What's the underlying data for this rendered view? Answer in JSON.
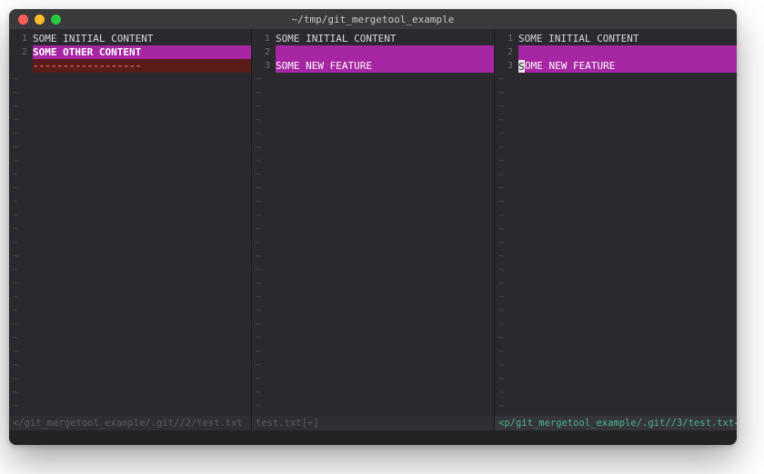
{
  "window": {
    "title": "~/tmp/git_mergetool_example"
  },
  "panes": [
    {
      "id": "local",
      "status_style": "inactive",
      "status_left": "</git_mergetool_example/.git//2/test.txt",
      "status_right": "",
      "lines": [
        {
          "num": "1",
          "kind": "plain",
          "text": "SOME INITIAL CONTENT"
        },
        {
          "num": "2",
          "kind": "purple-bold",
          "text": "SOME OTHER CONTENT"
        },
        {
          "num": "",
          "kind": "removed",
          "text": "------------------"
        }
      ]
    },
    {
      "id": "base",
      "status_style": "inactive",
      "status_left": "test.txt[+]",
      "status_right": "",
      "lines": [
        {
          "num": "1",
          "kind": "plain",
          "text": "SOME INITIAL CONTENT"
        },
        {
          "num": "2",
          "kind": "purple",
          "text": ""
        },
        {
          "num": "3",
          "kind": "purple",
          "text": "SOME NEW FEATURE"
        }
      ]
    },
    {
      "id": "remote",
      "status_style": "active",
      "status_left": "<p/git_mergetool_example/.git//3/test.txt",
      "status_right": "◀",
      "cursor_on_line": 3,
      "lines": [
        {
          "num": "1",
          "kind": "plain",
          "text": "SOME INITIAL CONTENT"
        },
        {
          "num": "2",
          "kind": "purple",
          "text": ""
        },
        {
          "num": "3",
          "kind": "purple-cursor",
          "text": "SOME NEW FEATURE"
        }
      ]
    }
  ],
  "tilde_rows": 27
}
